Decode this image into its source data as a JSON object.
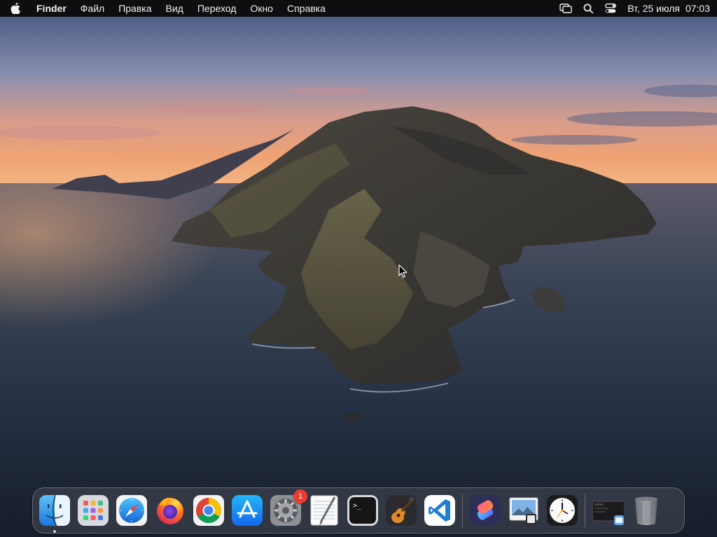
{
  "menubar": {
    "app_name": "Finder",
    "menus": [
      "Файл",
      "Правка",
      "Вид",
      "Переход",
      "Окно",
      "Справка"
    ],
    "status_icons": [
      "screen-mirroring-icon",
      "search-icon",
      "control-center-icon"
    ],
    "clock": {
      "day": "Вт, 25 июля",
      "time": "07:03"
    }
  },
  "dock": {
    "apps": [
      {
        "name": "Finder",
        "icon": "finder-icon",
        "running": true
      },
      {
        "name": "Launchpad",
        "icon": "launchpad-icon"
      },
      {
        "name": "Safari",
        "icon": "safari-icon"
      },
      {
        "name": "Firefox",
        "icon": "firefox-icon"
      },
      {
        "name": "Google Chrome",
        "icon": "chrome-icon"
      },
      {
        "name": "App Store",
        "icon": "app-store-icon"
      },
      {
        "name": "System Preferences",
        "icon": "system-preferences-icon",
        "badge": "1"
      },
      {
        "name": "TextEdit",
        "icon": "textedit-icon"
      },
      {
        "name": "Terminal",
        "icon": "terminal-icon"
      },
      {
        "name": "GarageBand",
        "icon": "garageband-icon"
      },
      {
        "name": "Visual Studio Code",
        "icon": "vscode-icon"
      }
    ],
    "recent": [
      {
        "name": "Shortcuts",
        "icon": "shortcuts-icon"
      },
      {
        "name": "Preview",
        "icon": "preview-icon"
      },
      {
        "name": "Clock",
        "icon": "clock-icon"
      }
    ],
    "utility": [
      {
        "name": "Downloads",
        "icon": "downloads-stack-icon"
      },
      {
        "name": "Trash",
        "icon": "trash-icon"
      }
    ]
  },
  "colors": {
    "menubar_bg": "#0e0e10",
    "badge_red": "#ee3b30",
    "vscode_blue": "#1f7fd4"
  }
}
